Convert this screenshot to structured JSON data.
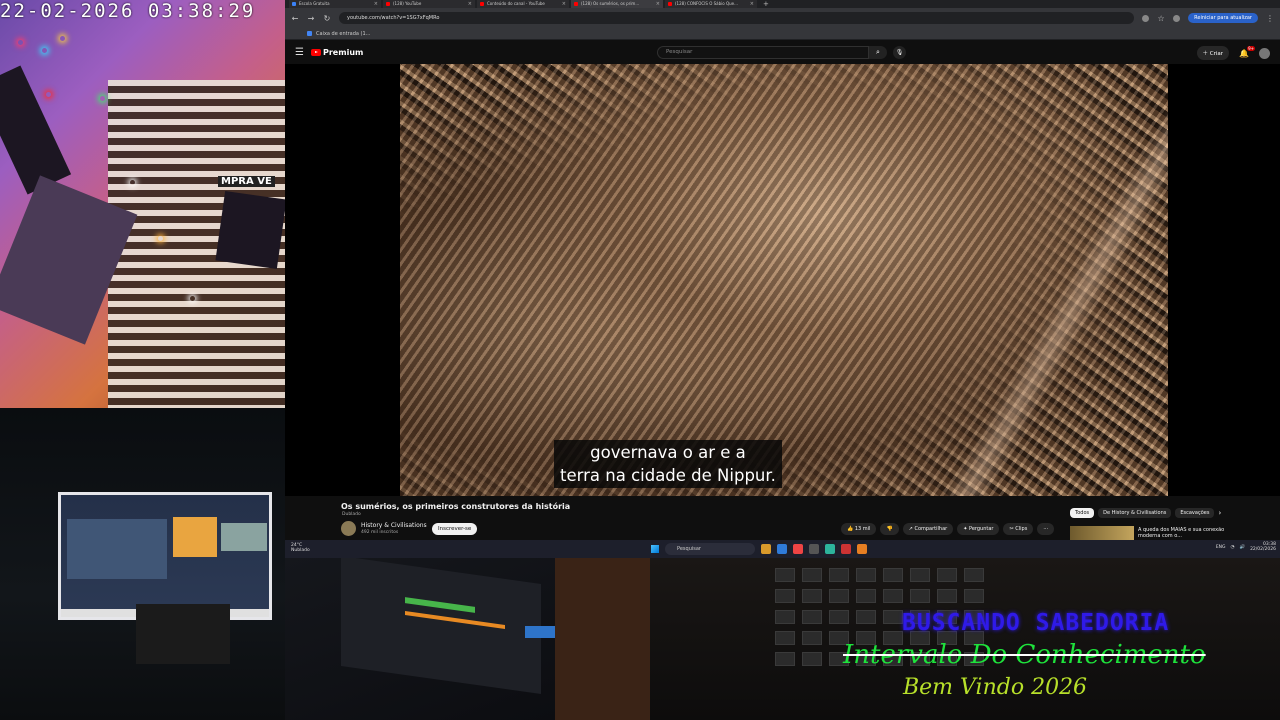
{
  "webcam": {
    "timestamp": "22-02-2026 03:38:29",
    "sign": "MPRA VE"
  },
  "browser": {
    "tabs": [
      {
        "label": "Escola Gratuita"
      },
      {
        "label": "(128) YouTube"
      },
      {
        "label": "Conteúdo do canal - YouTube"
      },
      {
        "label": "(128) Os sumérios, os prim..."
      },
      {
        "label": "(128) CONFOCIS O Sábio Que..."
      }
    ],
    "new_tab": "+",
    "url": "youtube.com/watch?v=1SG7xFqMRo",
    "relaunch": "Reiniciar para atualizar",
    "bookmark": "Caixa de entrada (1..."
  },
  "youtube": {
    "logo": "Premium",
    "logo_badge": "BR",
    "search_placeholder": "Pesquisar",
    "create": "Criar",
    "notif_count": "9+",
    "caption_line1": "governava o ar e a",
    "caption_line2": "terra na cidade de Nippur.",
    "video_title": "Os sumérios, os primeiros construtores da história",
    "dubbed": "Dublado",
    "channel_name": "History & Civilisations",
    "channel_subs": "492 mil inscritos",
    "subscribe": "Inscrever-se",
    "actions": {
      "likes": "13 mil",
      "share": "Compartilhar",
      "ask": "Perguntar",
      "clips": "Clips",
      "more": "···"
    },
    "chips": [
      "Todos",
      "De History & Civilisations",
      "Escavações"
    ],
    "rec_title": "A queda dos MAIAS e sua conexão moderna com o..."
  },
  "taskbar": {
    "weather_temp": "24°C",
    "weather_desc": "Nublado",
    "search": "Pesquisar",
    "lang": "ENG",
    "time": "03:38",
    "date": "22/02/2026"
  },
  "overlay": {
    "line1": "BUSCANDO SABEDORIA",
    "line2": "Intervalo Do Conhecimento",
    "line3": "Bem Vindo 2026"
  },
  "colors": {
    "youtube_red": "#ff0000",
    "overlay_blue": "#2f1ae8",
    "overlay_green": "#1ee33c",
    "overlay_lime": "#b7e02a"
  }
}
